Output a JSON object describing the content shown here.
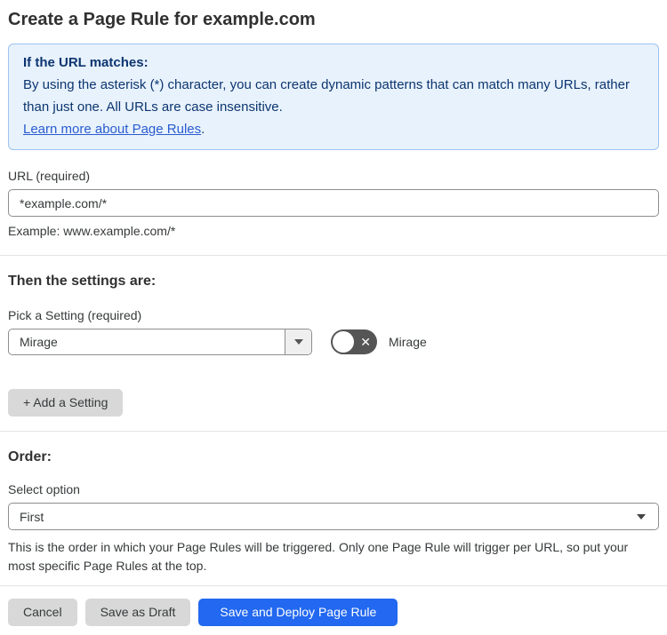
{
  "page": {
    "title": "Create a Page Rule for example.com"
  },
  "info_box": {
    "heading": "If the URL matches:",
    "body": "By using the asterisk (*) character, you can create dynamic patterns that can match many URLs, rather than just one. All URLs are case insensitive.",
    "link_label": "Learn more about Page Rules",
    "link_suffix": "."
  },
  "url_field": {
    "label": "URL (required)",
    "value": "*example.com/*",
    "helper": "Example: www.example.com/*"
  },
  "settings_section": {
    "heading": "Then the settings are:",
    "setting_label": "Pick a Setting (required)",
    "setting_value": "Mirage",
    "toggle": {
      "state": "off",
      "glyph": "✕",
      "label": "Mirage"
    },
    "add_setting_label": "+ Add a Setting"
  },
  "order_section": {
    "heading": "Order:",
    "select_label": "Select option",
    "select_value": "First",
    "helper": "This is the order in which your Page Rules will be triggered. Only one Page Rule will trigger per URL, so put your most specific Page Rules at the top."
  },
  "footer": {
    "cancel_label": "Cancel",
    "save_draft_label": "Save as Draft",
    "save_deploy_label": "Save and Deploy Page Rule"
  },
  "colors": {
    "info_background": "#e8f2fc",
    "info_border": "#9cc3ee",
    "info_text": "#0c3570",
    "link_blue": "#2a5cd0",
    "primary_button_blue": "#2268f0",
    "toggle_off_gray": "#555555"
  }
}
